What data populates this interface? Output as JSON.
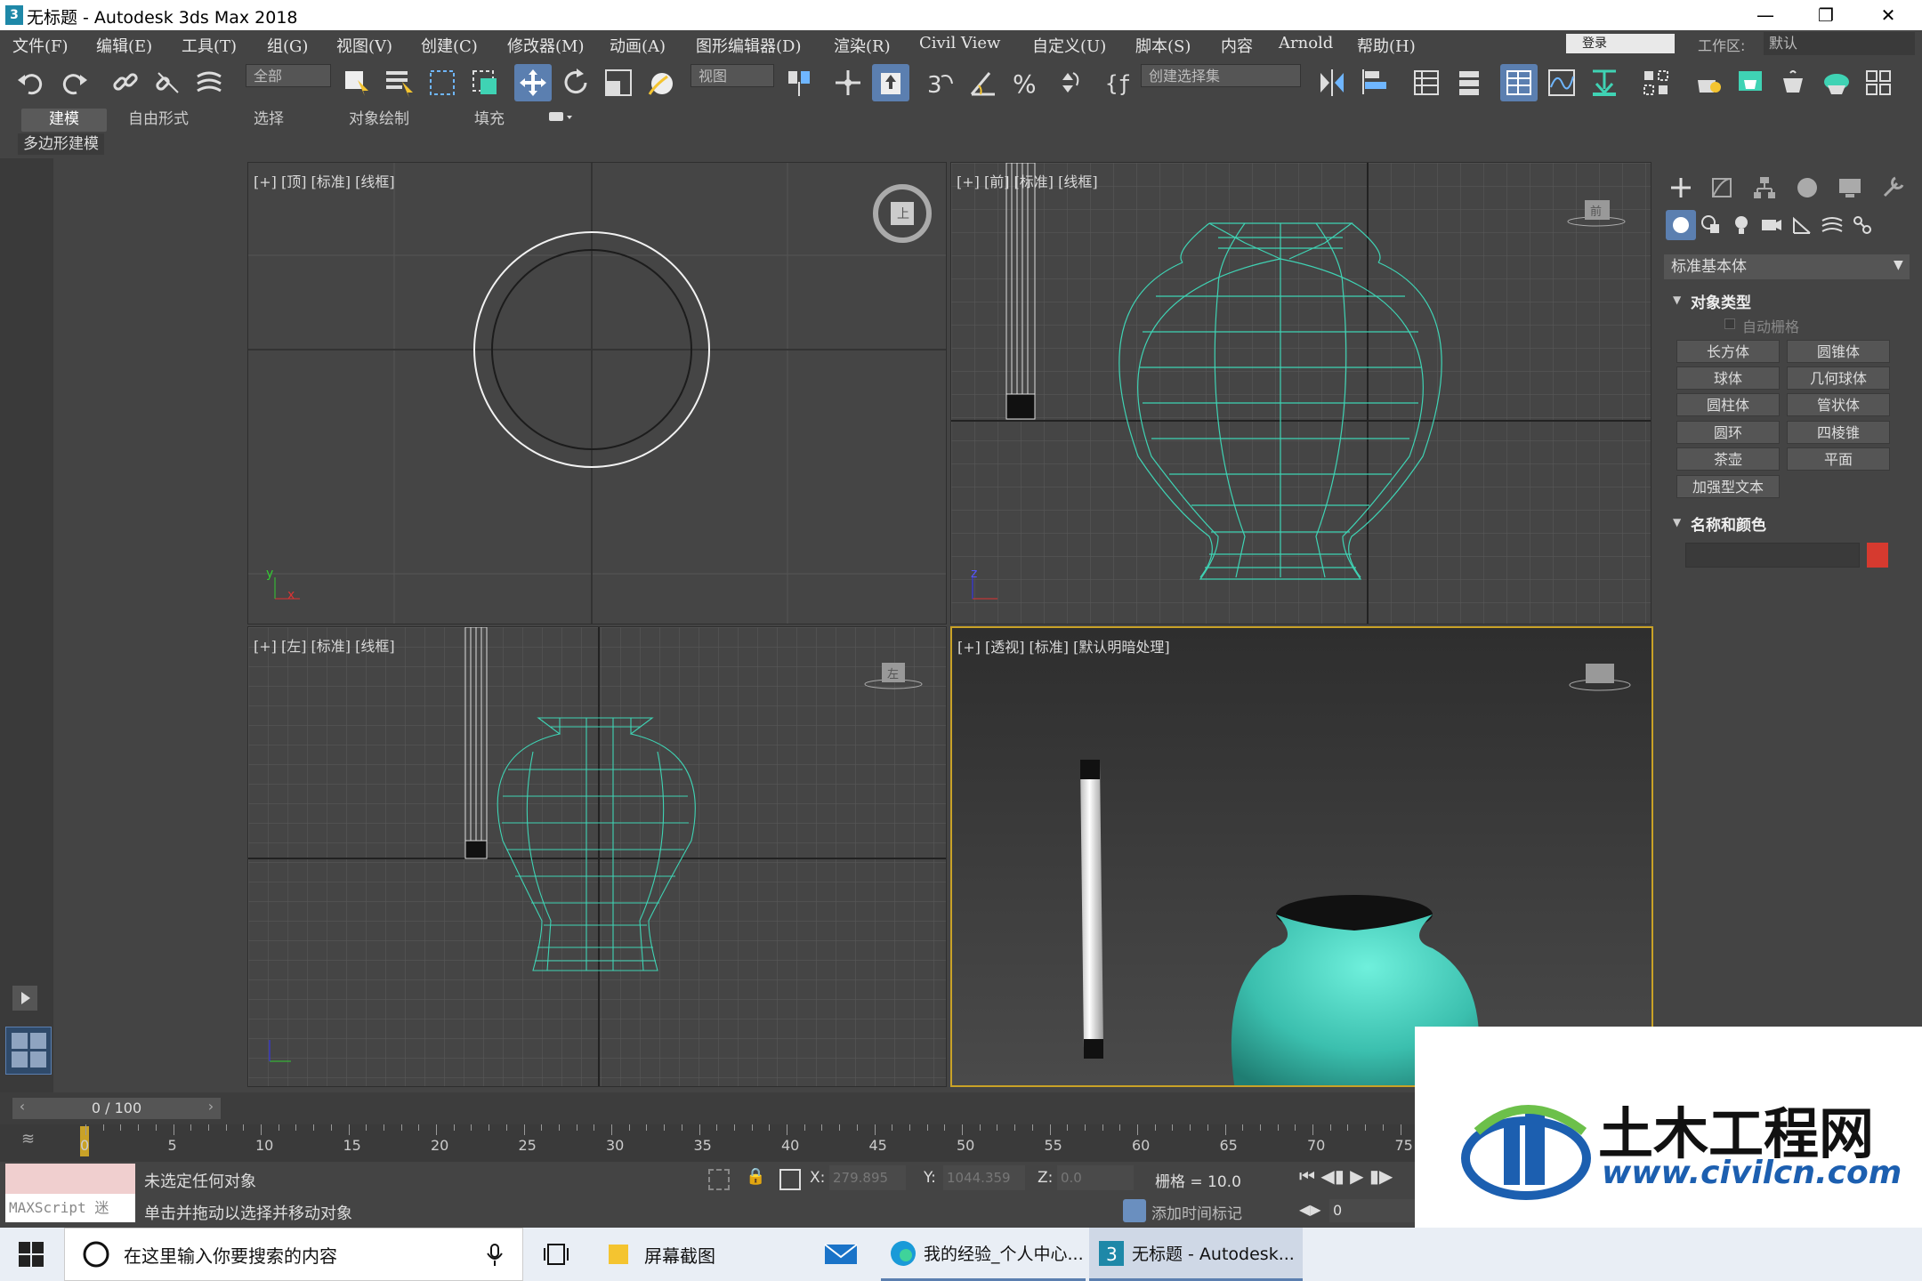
{
  "titlebar": {
    "title": "无标题 - Autodesk 3ds Max 2018",
    "icon_glyph": "3",
    "minimize": "—",
    "restore": "❐",
    "close": "✕"
  },
  "menu": {
    "items": [
      "文件(F)",
      "编辑(E)",
      "工具(T)",
      "组(G)",
      "视图(V)",
      "创建(C)",
      "修改器(M)",
      "动画(A)",
      "图形编辑器(D)",
      "渲染(R)",
      "Civil View",
      "自定义(U)",
      "脚本(S)",
      "内容",
      "Arnold",
      "帮助(H)"
    ],
    "login": "登录",
    "workspace_label": "工作区:",
    "workspace_value": "默认"
  },
  "toolbar": {
    "selection_filter": "全部",
    "ref_coord": "视图",
    "named_selection": "创建选择集"
  },
  "ribbon": {
    "tabs": [
      "建模",
      "自由形式",
      "选择",
      "对象绘制",
      "填充"
    ],
    "active": "建模",
    "sub_tab": "多边形建模"
  },
  "viewports": {
    "top": "[+] [顶] [标准] [线框]",
    "front": "[+] [前] [标准] [线框]",
    "left": "[+] [左] [标准] [线框]",
    "perspective": "[+] [透视] [标准] [默认明暗处理]",
    "viewcube_top": "上",
    "viewcube_front": "前",
    "viewcube_left": "左",
    "axis_x": "x",
    "axis_y": "y",
    "axis_z": "z"
  },
  "command_panel": {
    "category": "标准基本体",
    "object_type_title": "对象类型",
    "autogrid": "自动栅格",
    "buttons": [
      "长方体",
      "圆锥体",
      "球体",
      "几何球体",
      "圆柱体",
      "管状体",
      "圆环",
      "四棱锥",
      "茶壶",
      "平面",
      "加强型文本"
    ],
    "name_color_title": "名称和颜色",
    "object_color": "#d63a2f"
  },
  "time": {
    "slider": "0 / 100",
    "ticks": [
      "0",
      "5",
      "10",
      "15",
      "20",
      "25",
      "30",
      "35",
      "40",
      "45",
      "50",
      "55",
      "60",
      "65",
      "70",
      "75"
    ]
  },
  "status": {
    "maxscript": "MAXScript 迷",
    "line1": "未选定任何对象",
    "line2": "单击并拖动以选择并移动对象",
    "x_label": "X:",
    "x_value": "279.895",
    "y_label": "Y:",
    "y_value": "1044.359",
    "z_label": "Z:",
    "z_value": "0.0",
    "grid": "栅格 = 10.0",
    "add_time_tag": "添加时间标记",
    "frame": "0"
  },
  "taskbar": {
    "search": "在这里输入你要搜索的内容",
    "apps": [
      "屏幕截图",
      "我的经验_个人中心...",
      "无标题 - Autodesk..."
    ]
  },
  "watermark": {
    "title": "土木工程网",
    "url": "www.civilcn.com"
  },
  "colors": {
    "accent": "#5b7fb0",
    "wire": "#3fd3b4",
    "vase": "#3bbfae"
  }
}
